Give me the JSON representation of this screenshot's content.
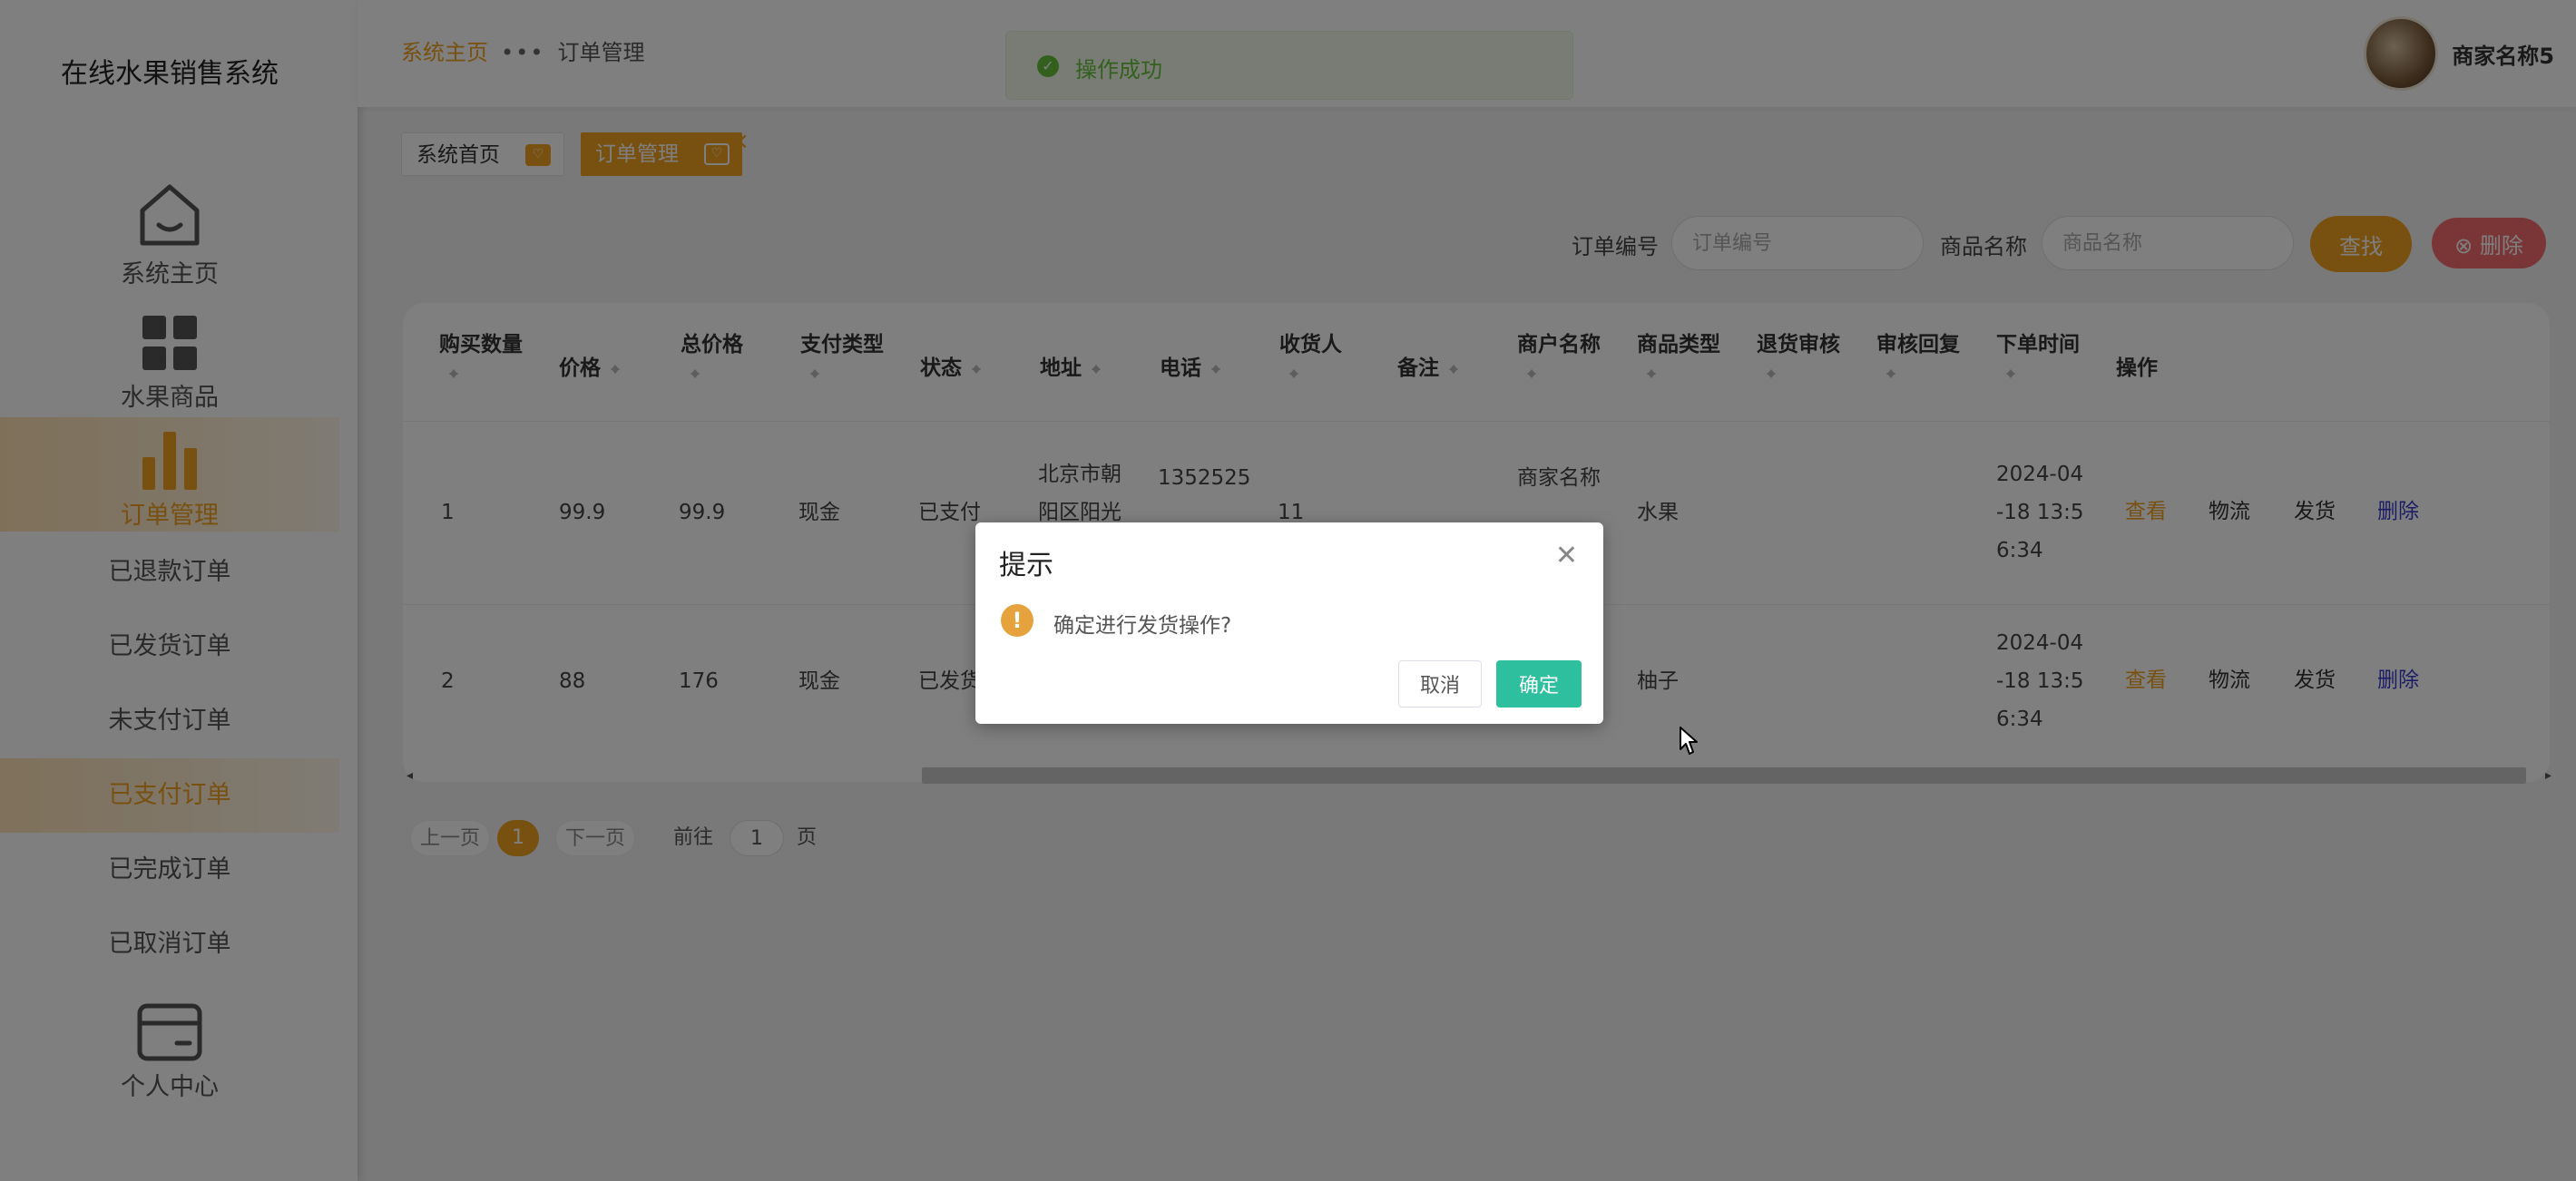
{
  "app": {
    "title": "在线水果销售系统"
  },
  "sidebar": {
    "items": [
      {
        "label": "系统主页",
        "icon": "home-icon"
      },
      {
        "label": "水果商品",
        "icon": "grid-icon"
      },
      {
        "label": "订单管理",
        "icon": "bar-chart-icon"
      },
      {
        "label": "已退款订单"
      },
      {
        "label": "已发货订单"
      },
      {
        "label": "未支付订单"
      },
      {
        "label": "已支付订单"
      },
      {
        "label": "已完成订单"
      },
      {
        "label": "已取消订单"
      },
      {
        "label": "个人中心",
        "icon": "card-icon"
      }
    ]
  },
  "header": {
    "breadcrumb_home": "系统主页",
    "breadcrumb_current": "订单管理",
    "user_name": "商家名称5"
  },
  "tags": [
    {
      "label": "系统首页"
    },
    {
      "label": "订单管理"
    }
  ],
  "search": {
    "order_no_label": "订单编号",
    "order_no_placeholder": "订单编号",
    "product_label": "商品名称",
    "product_placeholder": "商品名称",
    "find_label": "查找",
    "delete_label": "删除"
  },
  "table": {
    "headers": [
      "购买数量",
      "价格",
      "总价格",
      "支付类型",
      "状态",
      "地址",
      "电话",
      "收货人",
      "备注",
      "商户名称",
      "商品类型",
      "退货审核",
      "审核回复",
      "下单时间",
      "操作"
    ],
    "rows": [
      {
        "qty": "1",
        "price": "99.9",
        "total": "99.9",
        "pay": "现金",
        "status": "已支付",
        "addr1": "北京市朝",
        "addr2": "阳区阳光",
        "phone": "1352525",
        "receiver": "11",
        "merchant": "商家名称",
        "ptype": "水果",
        "time1": "2024-04",
        "time2": "-18 13:5",
        "time3": "6:34"
      },
      {
        "qty": "2",
        "price": "88",
        "total": "176",
        "pay": "现金",
        "status": "已发货",
        "ptype": "柚子",
        "time1": "2024-04",
        "time2": "-18 13:5",
        "time3": "6:34"
      }
    ],
    "ops": {
      "view": "查看",
      "logistics": "物流",
      "ship": "发货",
      "delete": "删除"
    }
  },
  "pagination": {
    "prev": "上一页",
    "current": "1",
    "next": "下一页",
    "goto": "前往",
    "page_input": "1",
    "page_unit": "页"
  },
  "toast": {
    "message": "操作成功"
  },
  "dialog": {
    "title": "提示",
    "message": "确定进行发货操作?",
    "cancel": "取消",
    "confirm": "确定"
  },
  "colors": {
    "accent": "#f0a11f",
    "danger": "#f56c6c",
    "confirm": "#2ebf9f",
    "success": "#67c23a",
    "warning": "#e6a23c"
  }
}
